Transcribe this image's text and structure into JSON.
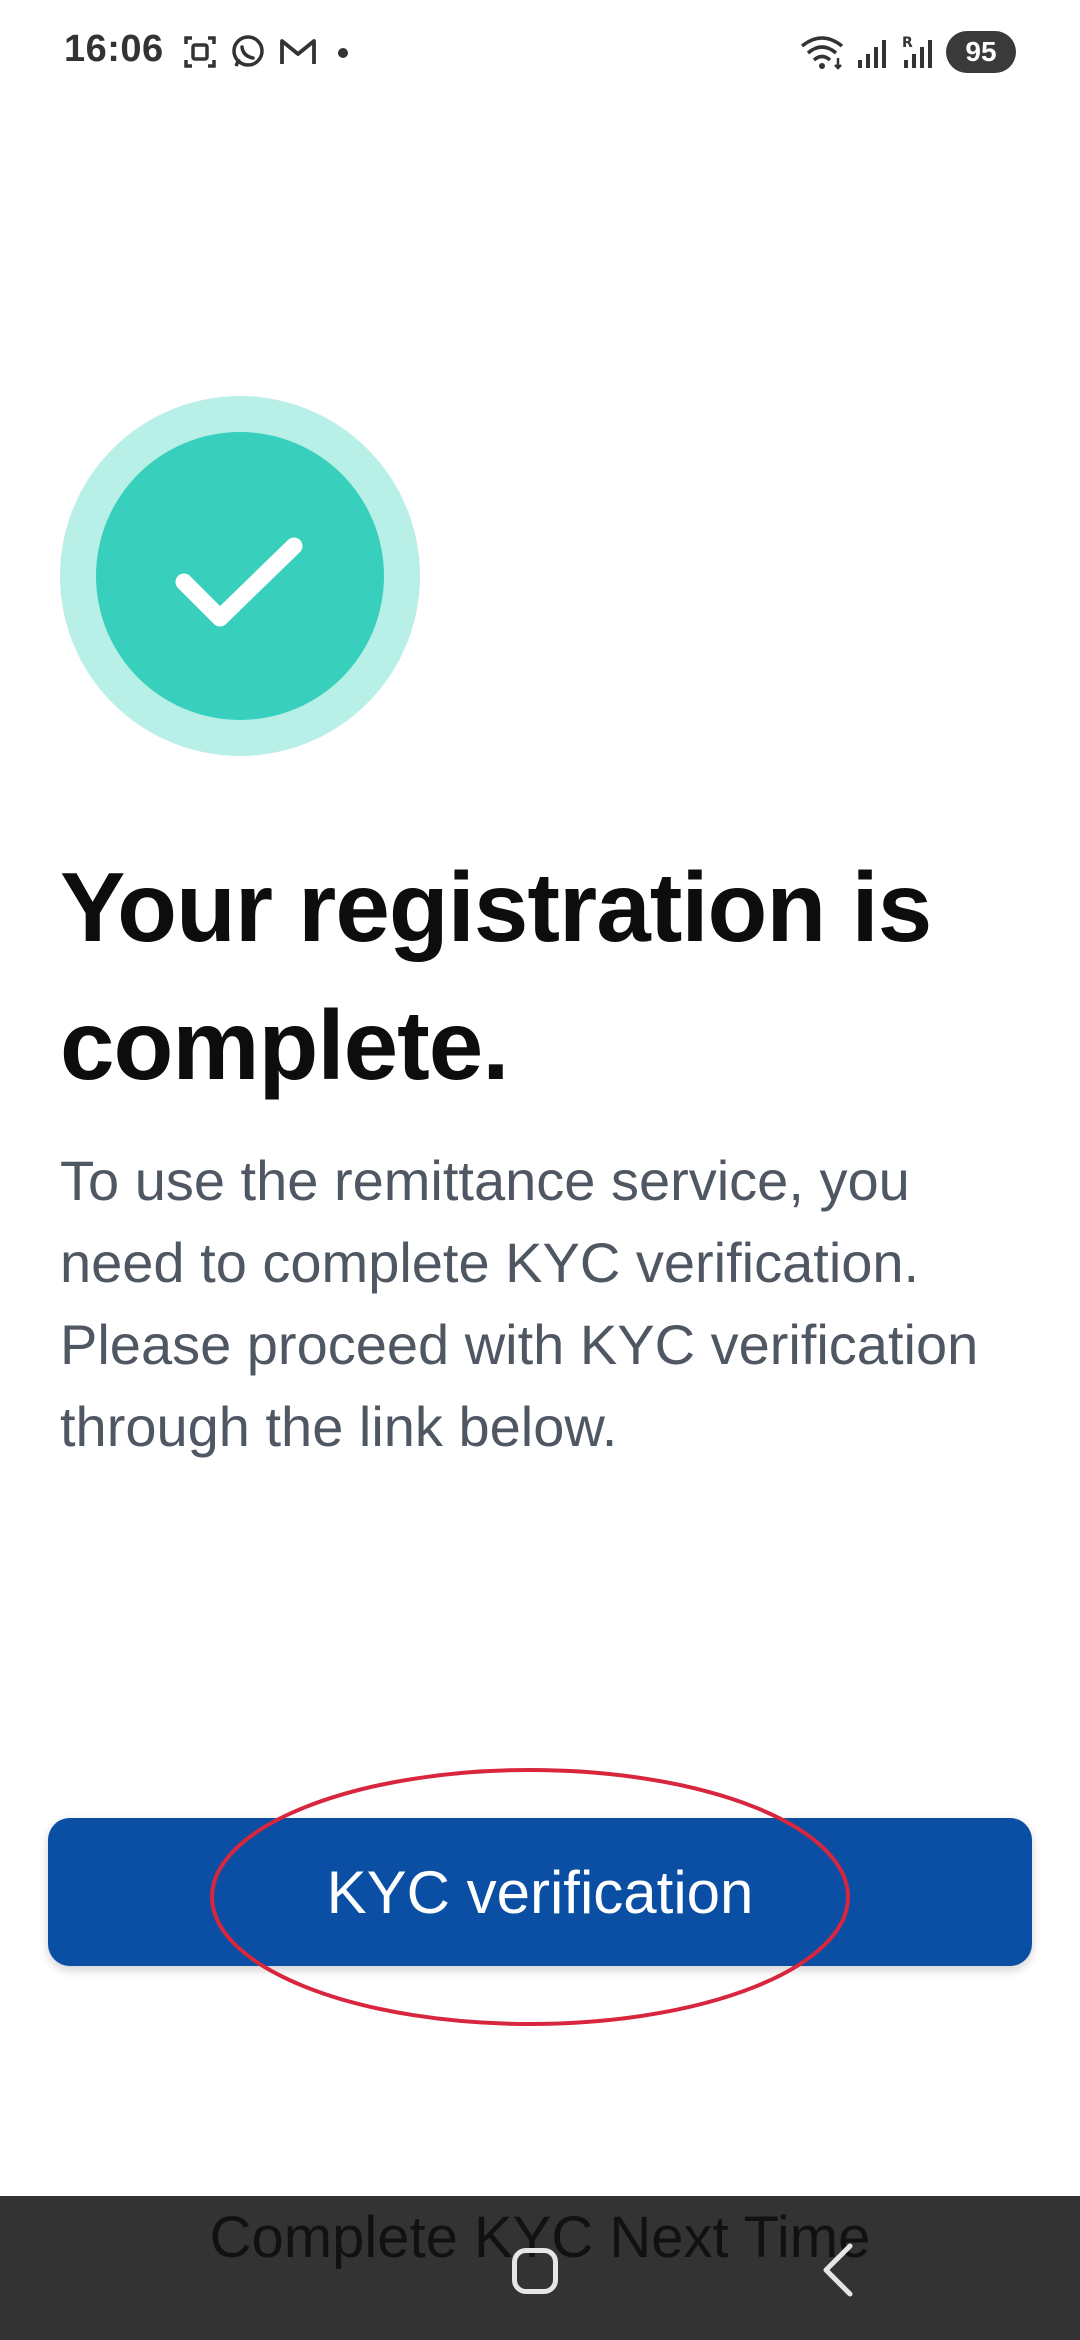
{
  "status_bar": {
    "time": "16:06",
    "left_icons": [
      "screenshot-icon",
      "whatsapp-icon",
      "gmail-icon",
      "notification-dot-icon"
    ],
    "right_icons": [
      "wifi-icon",
      "signal-icon",
      "roaming-signal-icon"
    ],
    "battery": "95"
  },
  "success": {
    "icon": "check-circle-icon",
    "colors": {
      "outer": "#b8f0e8",
      "inner": "#38cfbd",
      "check": "#ffffff"
    }
  },
  "headline": "Your registration is complete.",
  "description": "To use the remittance service, you need to complete KYC verification. Please proceed with KYC verification through the link below.",
  "kyc_button": {
    "label": "KYC verification",
    "color": "#0a4fa3"
  },
  "annotation": {
    "shape": "ellipse",
    "color": "#d7263d"
  },
  "next_time_link": "Complete KYC Next Time",
  "nav_bar": {
    "icons": [
      "home-icon",
      "back-icon"
    ]
  }
}
